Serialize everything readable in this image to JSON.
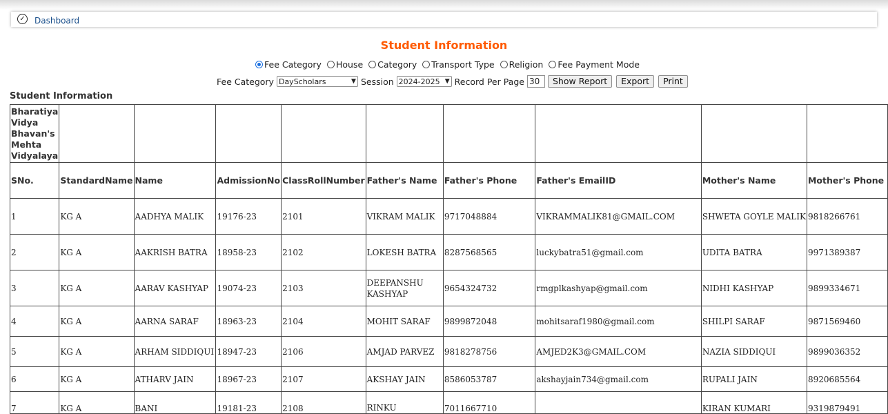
{
  "breadcrumb": {
    "icon": "check-circle-icon",
    "link": "Dashboard"
  },
  "title": "Student Information",
  "radio_options": [
    {
      "label": "Fee Category",
      "checked": true
    },
    {
      "label": "House",
      "checked": false
    },
    {
      "label": "Category",
      "checked": false
    },
    {
      "label": "Transport Type",
      "checked": false
    },
    {
      "label": "Religion",
      "checked": false
    },
    {
      "label": "Fee Payment Mode",
      "checked": false
    }
  ],
  "filters": {
    "fee_category_label": "Fee Category",
    "fee_category_value": "DayScholars",
    "session_label": "Session",
    "session_value": "2024-2025",
    "record_label": "Record Per Page",
    "record_value": "30",
    "show_report": "Show Report",
    "export": "Export",
    "print": "Print"
  },
  "section_label": "Student Information",
  "school_name": "Bharatiya Vidya Bhavan's Mehta Vidyalaya",
  "columns": [
    "SNo.",
    "StandardName",
    "Name",
    "AdmissionNo",
    "ClassRollNumber",
    "Father's Name",
    "Father's Phone",
    "Father's EmailID",
    "Mother's Name",
    "Mother's Phone"
  ],
  "rows": [
    [
      "1",
      "KG A",
      "AADHYA MALIK",
      "19176-23",
      "2101",
      "VIKRAM MALIK",
      "9717048884",
      "VIKRAMMALIK81@GMAIL.COM",
      "SHWETA GOYLE MALIK",
      "9818266761"
    ],
    [
      "2",
      "KG A",
      "AAKRISH BATRA",
      "18958-23",
      "2102",
      "LOKESH BATRA",
      "8287568565",
      "luckybatra51@gmail.com",
      "UDITA BATRA",
      "9971389387"
    ],
    [
      "3",
      "KG A",
      "AARAV KASHYAP",
      "19074-23",
      "2103",
      "DEEPANSHU KASHYAP",
      "9654324732",
      "rmgplkashyap@gmail.com",
      "NIDHI KASHYAP",
      "9899334671"
    ],
    [
      "4",
      "KG A",
      "AARNA SARAF",
      "18963-23",
      "2104",
      "MOHIT SARAF",
      "9899872048",
      "mohitsaraf1980@gmail.com",
      "SHILPI SARAF",
      "9871569460"
    ],
    [
      "5",
      "KG A",
      "ARHAM SIDDIQUI",
      "18947-23",
      "2106",
      "AMJAD PARVEZ",
      "9818278756",
      "AMJED2K3@GMAIL.COM",
      "NAZIA SIDDIQUI",
      "9899036352"
    ],
    [
      "6",
      "KG A",
      "ATHARV JAIN",
      "18967-23",
      "2107",
      "AKSHAY JAIN",
      "8586053787",
      "akshayjain734@gmail.com",
      "RUPALI JAIN",
      "8920685564"
    ],
    [
      "7",
      "KG A",
      "BANI",
      "19181-23",
      "2108",
      "RINKU",
      "7011667710",
      "",
      "KIRAN KUMARI",
      "9319879491"
    ]
  ]
}
